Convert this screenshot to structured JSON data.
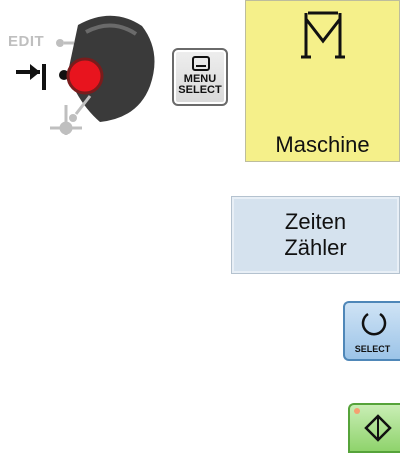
{
  "mode_selector": {
    "edit_label": "EDIT",
    "pointer_color": "#e8141e",
    "knob_color": "#3a3a3a"
  },
  "menu_select_key": {
    "line1": "MENU",
    "line2": "SELECT",
    "icon": "keyboard-icon"
  },
  "machine_softkey": {
    "label": "Maschine",
    "icon": "machine-m-icon",
    "color": "#f5f08a"
  },
  "times_counters_softkey": {
    "line1": "Zeiten",
    "line2": "Zähler",
    "color": "#d5e2ee"
  },
  "select_key": {
    "label": "SELECT",
    "icon": "select-ring-icon"
  },
  "cycle_start_key": {
    "icon": "cycle-start-diamond-icon",
    "color": "#8fd36c"
  }
}
